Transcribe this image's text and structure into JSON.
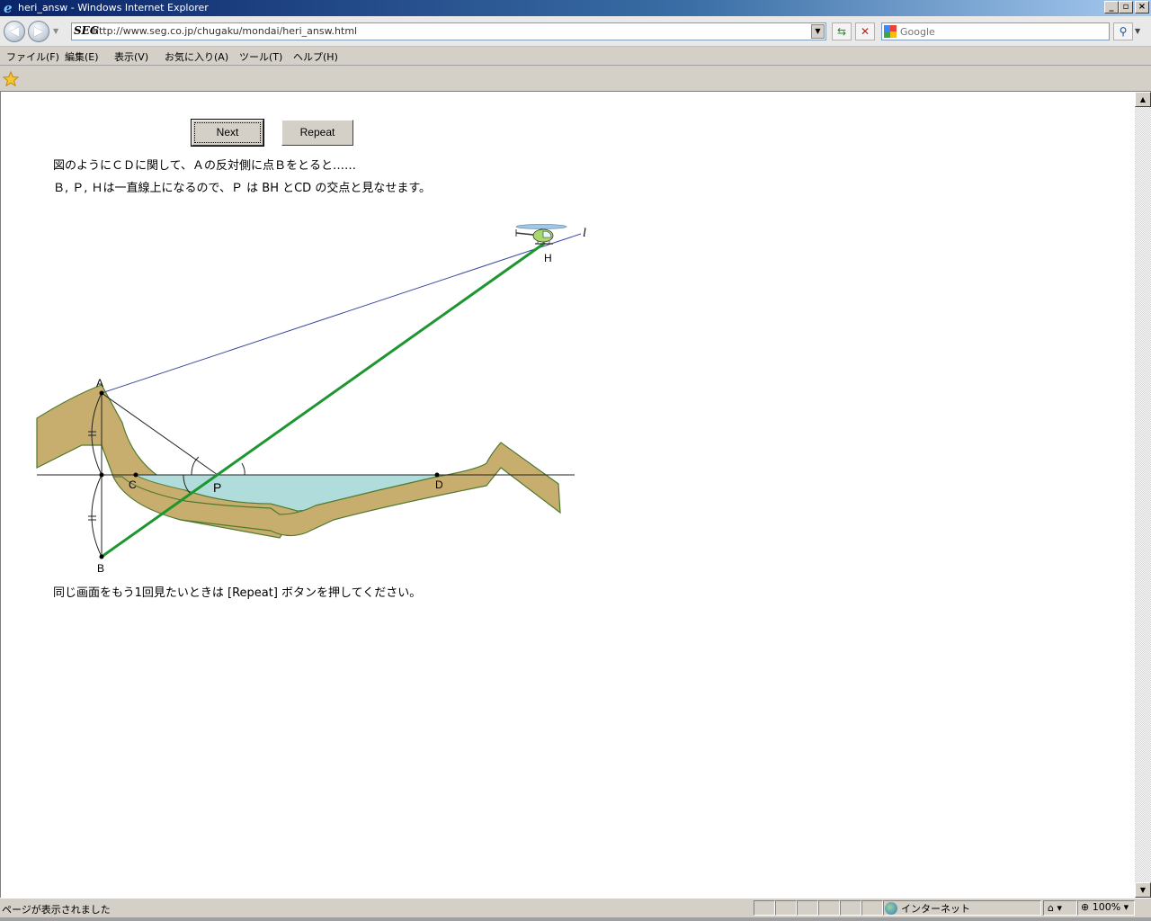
{
  "window": {
    "title": "heri_answ - Windows Internet Explorer",
    "controls": {
      "minimize": "_",
      "maximize": "▫",
      "close": "×"
    }
  },
  "addressbar": {
    "site_logo": "SEG",
    "url": "http://www.seg.co.jp/chugaku/mondai/heri_answ.html",
    "back_icon": "back-arrow-icon",
    "forward_icon": "forward-arrow-icon",
    "search_placeholder": "Google"
  },
  "menu": {
    "items": [
      "ファイル(F)",
      "編集(E)",
      "表示(V)",
      "お気に入り(A)",
      "ツール(T)",
      "ヘルプ(H)"
    ]
  },
  "page": {
    "buttons": {
      "next": "Next",
      "repeat": "Repeat"
    },
    "line1": "図のようにＣＤに関して、Ａの反対側に点Ｂをとると……",
    "line2": "Ｂ, Ｐ, Ｈは一直線上になるので、Ｐ は BH とCD の交点と見なせます。",
    "footer": "同じ画面をもう1回見たいときは [Repeat] ボタンを押してください。"
  },
  "figure": {
    "labels": {
      "A": "A",
      "B": "B",
      "C": "C",
      "D": "D",
      "P": "P",
      "H": "H",
      "l": "l"
    },
    "colors": {
      "bank": "#c8ae6e",
      "bank_edge": "#4e7a2e",
      "water": "#b0dcdc",
      "line_l": "#3a4aa0",
      "line_bh": "#1e9630",
      "helicopter": "#a8d86a"
    }
  },
  "status": {
    "message": "ページが表示されました",
    "zone": "インターネット",
    "zoom": "100%"
  }
}
